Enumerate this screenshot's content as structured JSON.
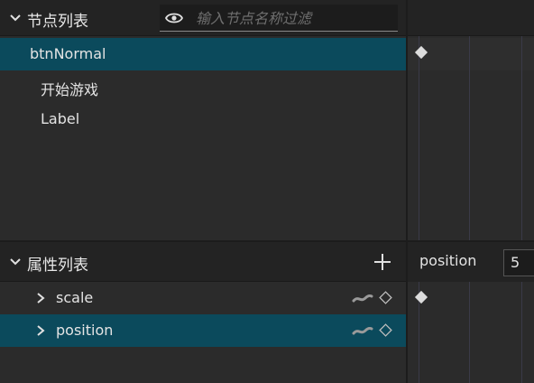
{
  "node_panel": {
    "title": "节点列表",
    "filter_placeholder": "输入节点名称过滤",
    "nodes": [
      {
        "label": "btnNormal",
        "selected": true
      },
      {
        "label": "开始游戏",
        "selected": false
      },
      {
        "label": "Label",
        "selected": false
      }
    ]
  },
  "property_panel": {
    "title": "属性列表",
    "properties": [
      {
        "label": "scale",
        "selected": false
      },
      {
        "label": "position",
        "selected": true
      }
    ]
  },
  "timeline": {
    "property_label": "position",
    "value": "5"
  },
  "icons": {
    "collapse": "chevron-down-icon",
    "eye": "eye-icon",
    "add": "plus-icon",
    "expand": "chevron-right-icon",
    "curve": "curve-icon",
    "keyframe": "keyframe-diamond-icon"
  },
  "colors": {
    "selection": "#0b4a5c",
    "header": "#232323",
    "panel": "#2b2b2b"
  }
}
